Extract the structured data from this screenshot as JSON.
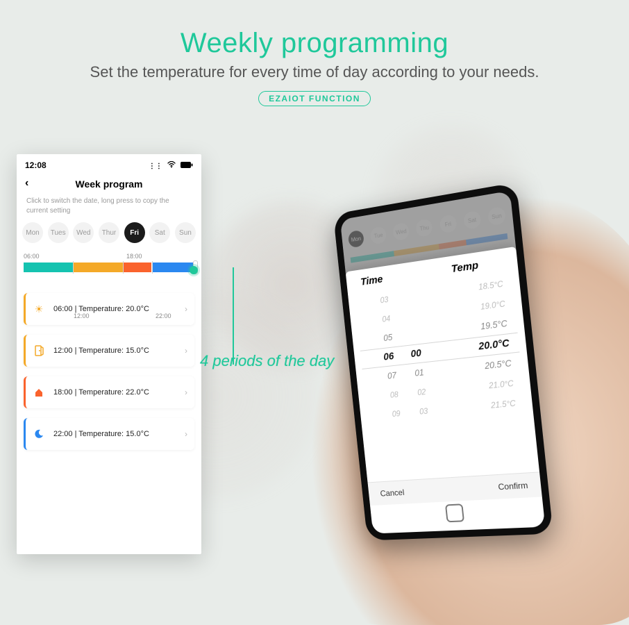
{
  "hero": {
    "title": "Weekly programming",
    "subtitle": "Set the temperature for every time of day according to your needs.",
    "badge": "EZAIOT FUNCTION",
    "annotation": "4 periods of the day"
  },
  "phone1": {
    "status_time": "12:08",
    "screen_title": "Week program",
    "help_text": "Click to switch the date, long press to copy the current setting",
    "days": [
      "Mon",
      "Tues",
      "Wed",
      "Thur",
      "Fri",
      "Sat",
      "Sun"
    ],
    "selected_day_index": 4,
    "timeline_labels": {
      "l0600": "06:00",
      "l1200": "12:00",
      "l1800": "18:00",
      "l2200": "22:00"
    },
    "rows": {
      "r1": "06:00  |  Temperature: 20.0°C",
      "r2": "12:00  |  Temperature: 15.0°C",
      "r3": "18:00  |  Temperature: 22.0°C",
      "r4": "22:00  |  Temperature: 15.0°C"
    }
  },
  "phone2": {
    "days": [
      "Mon",
      "Tue",
      "Wed",
      "Thu",
      "Fri",
      "Sat",
      "Sun"
    ],
    "selected_day_index": 0,
    "sheet": {
      "col_time": "Time",
      "col_temp": "Temp",
      "hour_items": [
        "03",
        "04",
        "05",
        "06",
        "07",
        "08",
        "09"
      ],
      "minute_items": [
        "",
        "",
        "",
        "00",
        "01",
        "02",
        "03"
      ],
      "temp_items": [
        "18.5°C",
        "19.0°C",
        "19.5°C",
        "20.0°C",
        "20.5°C",
        "21.0°C",
        "21.5°C"
      ],
      "selected_index": 3,
      "cancel": "Cancel",
      "confirm": "Confirm"
    }
  }
}
